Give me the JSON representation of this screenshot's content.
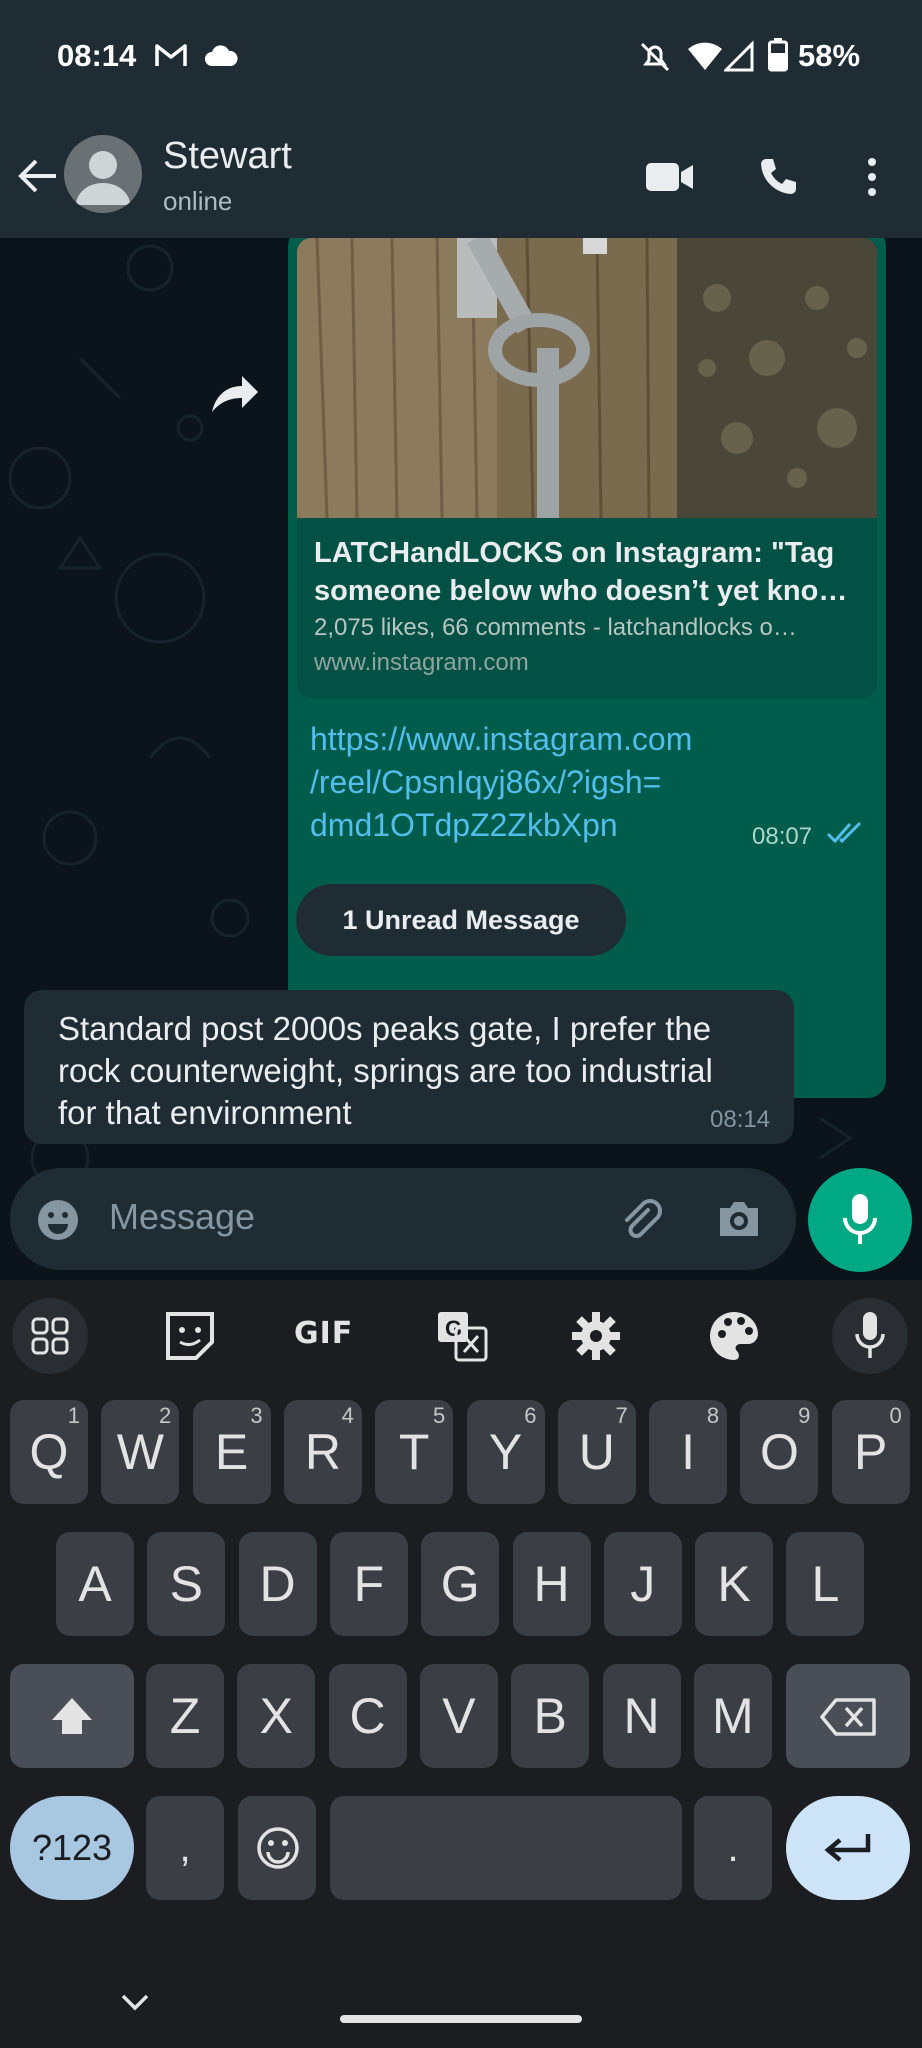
{
  "status_bar": {
    "time": "08:14",
    "battery": "58%",
    "icons": [
      "gmail-icon",
      "cloud-icon",
      "muted-icon",
      "wifi-icon",
      "signal-icon",
      "battery-icon"
    ]
  },
  "header": {
    "contact_name": "Stewart",
    "contact_status": "online",
    "icons": [
      "back-arrow-icon",
      "avatar",
      "video-call-icon",
      "voice-call-icon",
      "more-options-icon"
    ]
  },
  "outgoing_message": {
    "preview": {
      "title_line1": "LATCHandLOCKS on Instagram: \"Tag",
      "title_line2": "someone below who doesn’t yet kno…",
      "description": "2,075 likes, 66 comments - latchandlocks o…",
      "domain": "www.instagram.com"
    },
    "link_line1": "https://www.instagram.com",
    "link_line2": "/reel/CpsnIqyj86x/?igsh=",
    "link_line3": "dmd1OTdpZ2ZkbXpn",
    "time": "08:07",
    "status": "read"
  },
  "unread_divider": "1 Unread Message",
  "incoming_message": {
    "line1": "Standard post 2000s peaks gate, I prefer the",
    "line2": "rock counterweight, springs are too industrial",
    "line3": "for that environment",
    "time": "08:14"
  },
  "composer": {
    "placeholder": "Message"
  },
  "keyboard": {
    "toolbar": {
      "gif": "GIF"
    },
    "row1": [
      {
        "k": "Q",
        "h": "1"
      },
      {
        "k": "W",
        "h": "2"
      },
      {
        "k": "E",
        "h": "3"
      },
      {
        "k": "R",
        "h": "4"
      },
      {
        "k": "T",
        "h": "5"
      },
      {
        "k": "Y",
        "h": "6"
      },
      {
        "k": "U",
        "h": "7"
      },
      {
        "k": "I",
        "h": "8"
      },
      {
        "k": "O",
        "h": "9"
      },
      {
        "k": "P",
        "h": "0"
      }
    ],
    "row2": [
      "A",
      "S",
      "D",
      "F",
      "G",
      "H",
      "J",
      "K",
      "L"
    ],
    "row3": [
      "Z",
      "X",
      "C",
      "V",
      "B",
      "N",
      "M"
    ],
    "row4": {
      "symbols": "?123",
      "comma": ",",
      "period": "."
    }
  },
  "colors": {
    "app_bar": "#1f2c34",
    "outgoing_bubble": "#005c4b",
    "link": "#53bdeb",
    "accent": "#00a884",
    "read_ticks": "#53bdeb"
  }
}
